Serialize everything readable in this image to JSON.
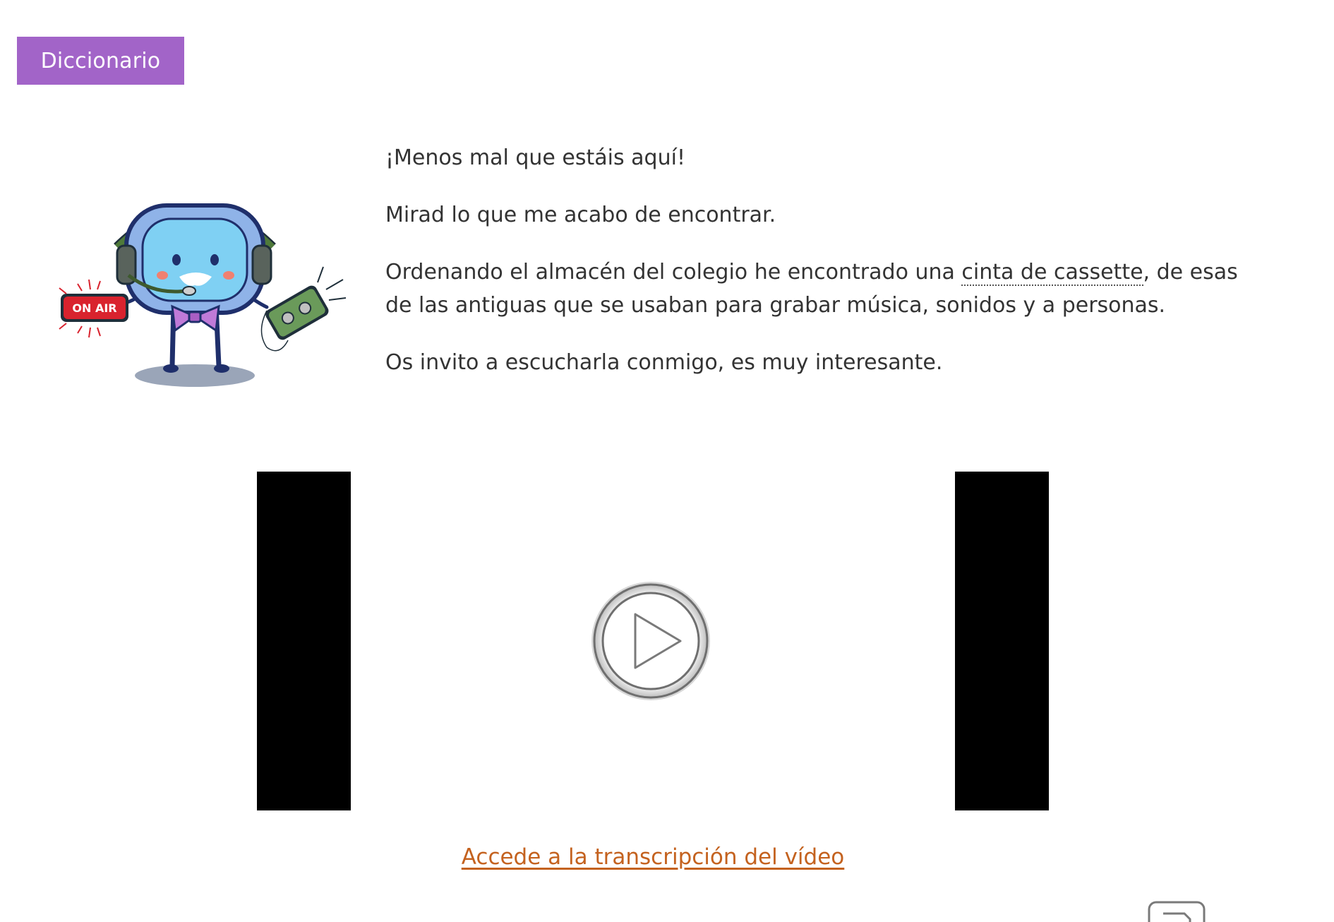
{
  "header": {
    "dictionary_button_label": "Diccionario"
  },
  "mascot": {
    "on_air_label": "ON AIR"
  },
  "intro": {
    "line1": "¡Menos mal que estáis aquí!",
    "line2": "Mirad lo que me acabo de encontrar.",
    "line3_before": "Ordenando el almacén del colegio he encontrado una ",
    "line3_term": "cinta de cassette",
    "line3_after": ", de esas de las antiguas que se usaban para grabar música, sonidos y a personas.",
    "line4": "Os invito a escucharla conmigo, es muy interesante."
  },
  "video": {
    "play_icon": "play-icon"
  },
  "transcript": {
    "link_label": "Accede a la transcripción del vídeo"
  },
  "colors": {
    "dictionary_button_bg": "#a264c8",
    "link": "#c4621f",
    "text": "#333333"
  }
}
